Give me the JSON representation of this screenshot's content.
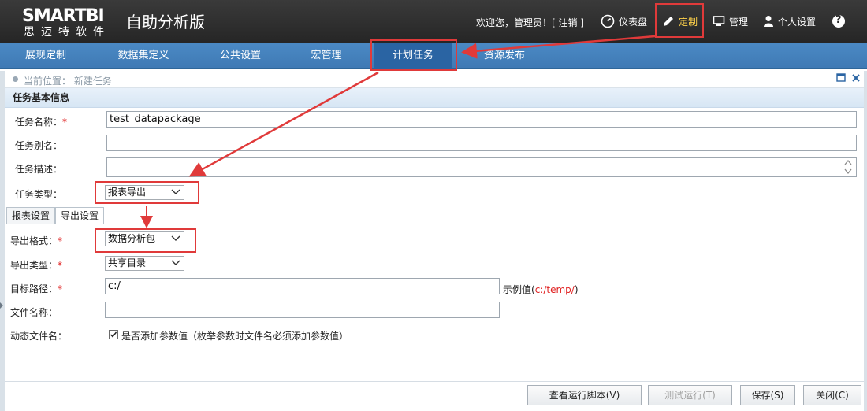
{
  "brand": {
    "logo": "SMARTBI",
    "logo_sub": "思迈特软件",
    "app_title": "自助分析版"
  },
  "header": {
    "welcome": "欢迎您，管理员！[ 注销 ]",
    "links": {
      "dashboard": "仪表盘",
      "custom": "定制",
      "manage": "管理",
      "personal": "个人设置",
      "help": "?"
    }
  },
  "nav": {
    "items": [
      {
        "label": "展现定制"
      },
      {
        "label": "数据集定义"
      },
      {
        "label": "公共设置"
      },
      {
        "label": "宏管理"
      },
      {
        "label": "计划任务"
      },
      {
        "label": "资源发布"
      }
    ],
    "active": "计划任务"
  },
  "breadcrumb": {
    "text": "当前位置： 新建任务"
  },
  "section": {
    "title": "任务基本信息"
  },
  "form": {
    "name_label": "任务名称：",
    "name_value": "test_datapackage",
    "alias_label": "任务别名：",
    "alias_value": "",
    "desc_label": "任务描述：",
    "desc_value": "",
    "type_label": "任务类型：",
    "type_value": "报表导出"
  },
  "tabs": [
    {
      "label": "报表设置"
    },
    {
      "label": "导出设置"
    }
  ],
  "export": {
    "format_label": "导出格式：",
    "format_value": "数据分析包",
    "export_type_label": "导出类型：",
    "export_type_value": "共享目录",
    "target_label": "目标路径：",
    "target_value": "c:/",
    "example_label": "示例值(",
    "example_value": "c:/temp/",
    "example_close": ")",
    "filename_label": "文件名称：",
    "filename_value": "",
    "dynamic_label": "动态文件名：",
    "dynamic_checkbox_label": "是否添加参数值（枚举参数时文件名必须添加参数值）",
    "dynamic_checked": true
  },
  "buttons": {
    "view_script": "查看运行脚本(V)",
    "test_run": "测试运行(T)",
    "save": "保存(S)",
    "close": "关闭(C)"
  },
  "colors": {
    "accent": "#4b8ac5",
    "highlight": "#e03a3a",
    "required": "#e02020"
  }
}
